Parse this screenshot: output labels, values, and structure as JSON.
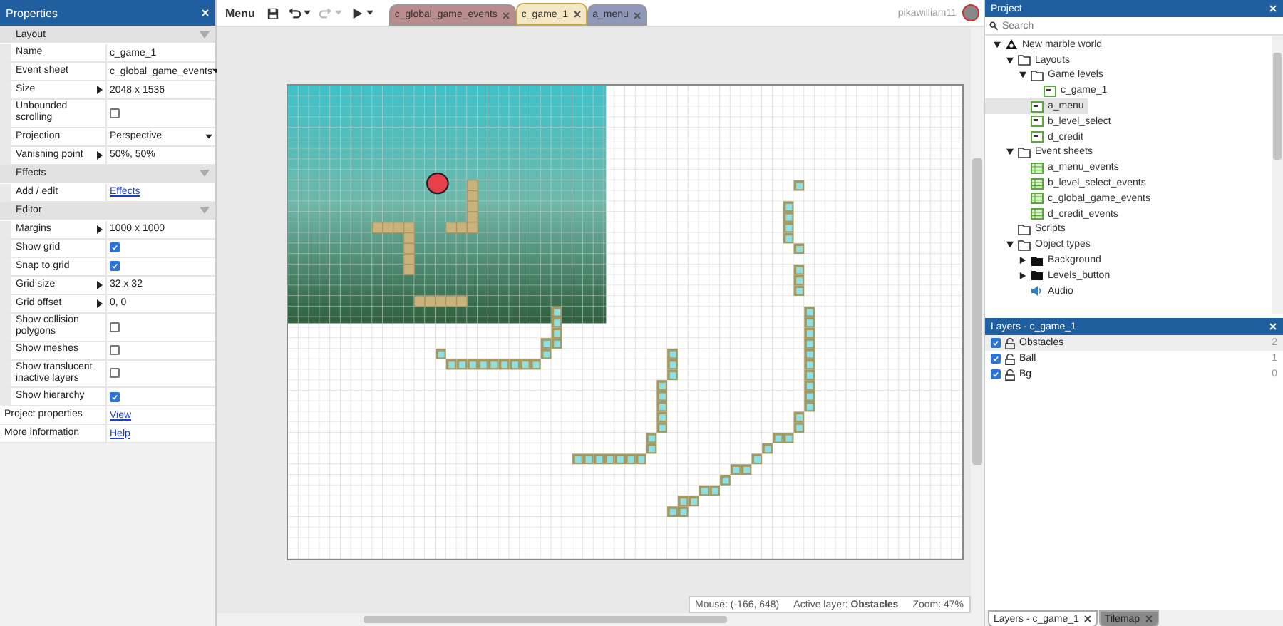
{
  "properties": {
    "title": "Properties",
    "sections": [
      {
        "title": "Layout",
        "rows": [
          {
            "label": "Name",
            "kind": "text",
            "value": "c_game_1"
          },
          {
            "label": "Event sheet",
            "kind": "dropdown",
            "value": "c_global_game_events"
          },
          {
            "label": "Size",
            "kind": "expandable",
            "value": "2048 x 1536"
          },
          {
            "label": "Unbounded scrolling",
            "kind": "checkbox",
            "checked": false
          },
          {
            "label": "Projection",
            "kind": "dropdown",
            "value": "Perspective"
          },
          {
            "label": "Vanishing point",
            "kind": "expandable",
            "value": "50%, 50%"
          }
        ]
      },
      {
        "title": "Effects",
        "rows": [
          {
            "label": "Add / edit",
            "kind": "link",
            "value": "Effects"
          }
        ]
      },
      {
        "title": "Editor",
        "rows": [
          {
            "label": "Margins",
            "kind": "expandable",
            "value": "1000 x 1000"
          },
          {
            "label": "Show grid",
            "kind": "checkbox",
            "checked": true
          },
          {
            "label": "Snap to grid",
            "kind": "checkbox",
            "checked": true
          },
          {
            "label": "Grid size",
            "kind": "expandable",
            "value": "32 x 32"
          },
          {
            "label": "Grid offset",
            "kind": "expandable",
            "value": "0, 0"
          },
          {
            "label": "Show collision polygons",
            "kind": "checkbox",
            "checked": false
          },
          {
            "label": "Show meshes",
            "kind": "checkbox",
            "checked": false
          },
          {
            "label": "Show translucent inactive layers",
            "kind": "checkbox",
            "checked": false
          },
          {
            "label": "Show hierarchy",
            "kind": "checkbox",
            "checked": true
          }
        ]
      }
    ],
    "footer_rows": [
      {
        "label": "Project properties",
        "kind": "link",
        "value": "View"
      },
      {
        "label": "More information",
        "kind": "link",
        "value": "Help"
      }
    ]
  },
  "toolbar": {
    "menu": "Menu",
    "buttons": [
      {
        "kind": "save",
        "disabled": false
      },
      {
        "kind": "undo",
        "disabled": false
      },
      {
        "kind": "redo",
        "disabled": true
      },
      {
        "kind": "run",
        "disabled": false
      }
    ],
    "tabs": [
      {
        "label": "c_global_game_events",
        "color": "#b98d8d",
        "selected": false
      },
      {
        "label": "c_game_1",
        "color": "#f4e8c4",
        "selected": true
      },
      {
        "label": "a_menu",
        "color": "#8e98b9",
        "selected": false
      }
    ],
    "user": "pikawilliam11"
  },
  "status_bar": {
    "mouse": "Mouse: (-166, 648)",
    "active_layer": "Active layer: **Obstacles**",
    "zoom": "Zoom: 47%"
  },
  "project": {
    "title": "Project",
    "search_placeholder": "Search",
    "tree": [
      {
        "label": "New marble world",
        "kind": "project",
        "expanded": true,
        "selected": false,
        "children": [
          {
            "label": "Layouts",
            "kind": "folder",
            "expanded": true,
            "selected": false,
            "children": [
              {
                "label": "Game levels",
                "kind": "folder",
                "expanded": true,
                "selected": false,
                "children": [
                  {
                    "label": "c_game_1",
                    "kind": "layout",
                    "selected": false
                  }
                ]
              },
              {
                "label": "a_menu",
                "kind": "layout",
                "selected": true
              },
              {
                "label": "b_level_select",
                "kind": "layout",
                "selected": false
              },
              {
                "label": "d_credit",
                "kind": "layout",
                "selected": false
              }
            ]
          },
          {
            "label": "Event sheets",
            "kind": "folder",
            "expanded": true,
            "selected": false,
            "children": [
              {
                "label": "a_menu_events",
                "kind": "eventsheet",
                "selected": false
              },
              {
                "label": "b_level_select_events",
                "kind": "eventsheet",
                "selected": false
              },
              {
                "label": "c_global_game_events",
                "kind": "eventsheet",
                "selected": false
              },
              {
                "label": "d_credit_events",
                "kind": "eventsheet",
                "selected": false
              }
            ]
          },
          {
            "label": "Scripts",
            "kind": "folder",
            "selected": false
          },
          {
            "label": "Object types",
            "kind": "folder",
            "expanded": true,
            "selected": false,
            "children": [
              {
                "label": "Background",
                "kind": "objectfolder",
                "expanded": false,
                "selected": false
              },
              {
                "label": "Levels_button",
                "kind": "objectfolder",
                "expanded": false,
                "selected": false
              },
              {
                "label": "Audio",
                "kind": "audio",
                "selected": false
              }
            ]
          }
        ]
      }
    ]
  },
  "layers": {
    "title": "Layers - c_game_1",
    "items": [
      {
        "name": "Obstacles",
        "visible": true,
        "count": "2",
        "selected": true
      },
      {
        "name": "Ball",
        "visible": true,
        "count": "1",
        "selected": false
      },
      {
        "name": "Bg",
        "visible": true,
        "count": "0",
        "selected": false
      }
    ]
  },
  "bottom_tabs": [
    {
      "label": "Layers - c_game_1",
      "selected": true
    },
    {
      "label": "Tilemap",
      "selected": false
    }
  ]
}
